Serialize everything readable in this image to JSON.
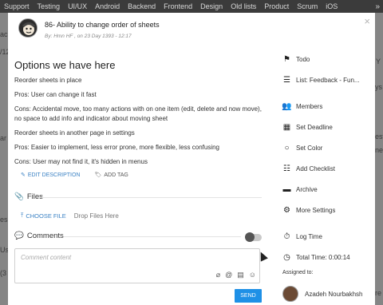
{
  "background": {
    "tabs": [
      "Support",
      "Testing",
      "UI/UX",
      "Android",
      "Backend",
      "Frontend",
      "Design",
      "Old lists",
      "Product",
      "Scrum",
      "iOS"
    ],
    "more": "»",
    "fragments": [
      "aci",
      "/12",
      "Y",
      "ys",
      "ar",
      "esto",
      "ne",
      "es",
      "Us",
      "(3",
      "re"
    ]
  },
  "card": {
    "title": "86- Ability to change order of sheets",
    "meta": "By: Hmn HF , on 23 Day 1393 - 12:17",
    "description_heading": "Options we have here",
    "paragraphs": [
      "Reorder sheets in place",
      "Pros: User can change it fast",
      "Cons: Accidental move, too many actions with on one item (edit, delete and now move), no space to add info and indicator about moving sheet",
      "Reorder sheets in another page in settings",
      "Pros: Easier to implement, less error prone, more flexible, less confusing",
      "Cons: User may not find it, it's hidden in menus"
    ],
    "edit_description": "EDIT DESCRIPTION",
    "add_tag": "ADD TAG",
    "files_label": "Files",
    "choose_file": "CHOOSE FILE",
    "drop_files": "Drop Files Here",
    "comments_label": "Comments",
    "comment_placeholder": "Comment content",
    "send": "SEND",
    "close": "×"
  },
  "sidebar": {
    "items": [
      {
        "icon": "flag-icon",
        "label": "Todo"
      },
      {
        "icon": "list-icon",
        "label": "List: Feedback - Fun..."
      },
      {
        "icon": "members-icon",
        "label": "Members"
      },
      {
        "icon": "calendar-icon",
        "label": "Set Deadline"
      },
      {
        "icon": "circle-icon",
        "label": "Set Color"
      },
      {
        "icon": "checklist-icon",
        "label": "Add Checklist"
      },
      {
        "icon": "archive-icon",
        "label": "Archive"
      },
      {
        "icon": "gear-icon",
        "label": "More Settings"
      },
      {
        "icon": "stopwatch-icon",
        "label": "Log Time"
      },
      {
        "icon": "clock-icon",
        "label": "Total Time: 0:00:14"
      }
    ],
    "assigned_to": "Assigned to:",
    "assignee": "Azadeh Nourbakhsh"
  }
}
